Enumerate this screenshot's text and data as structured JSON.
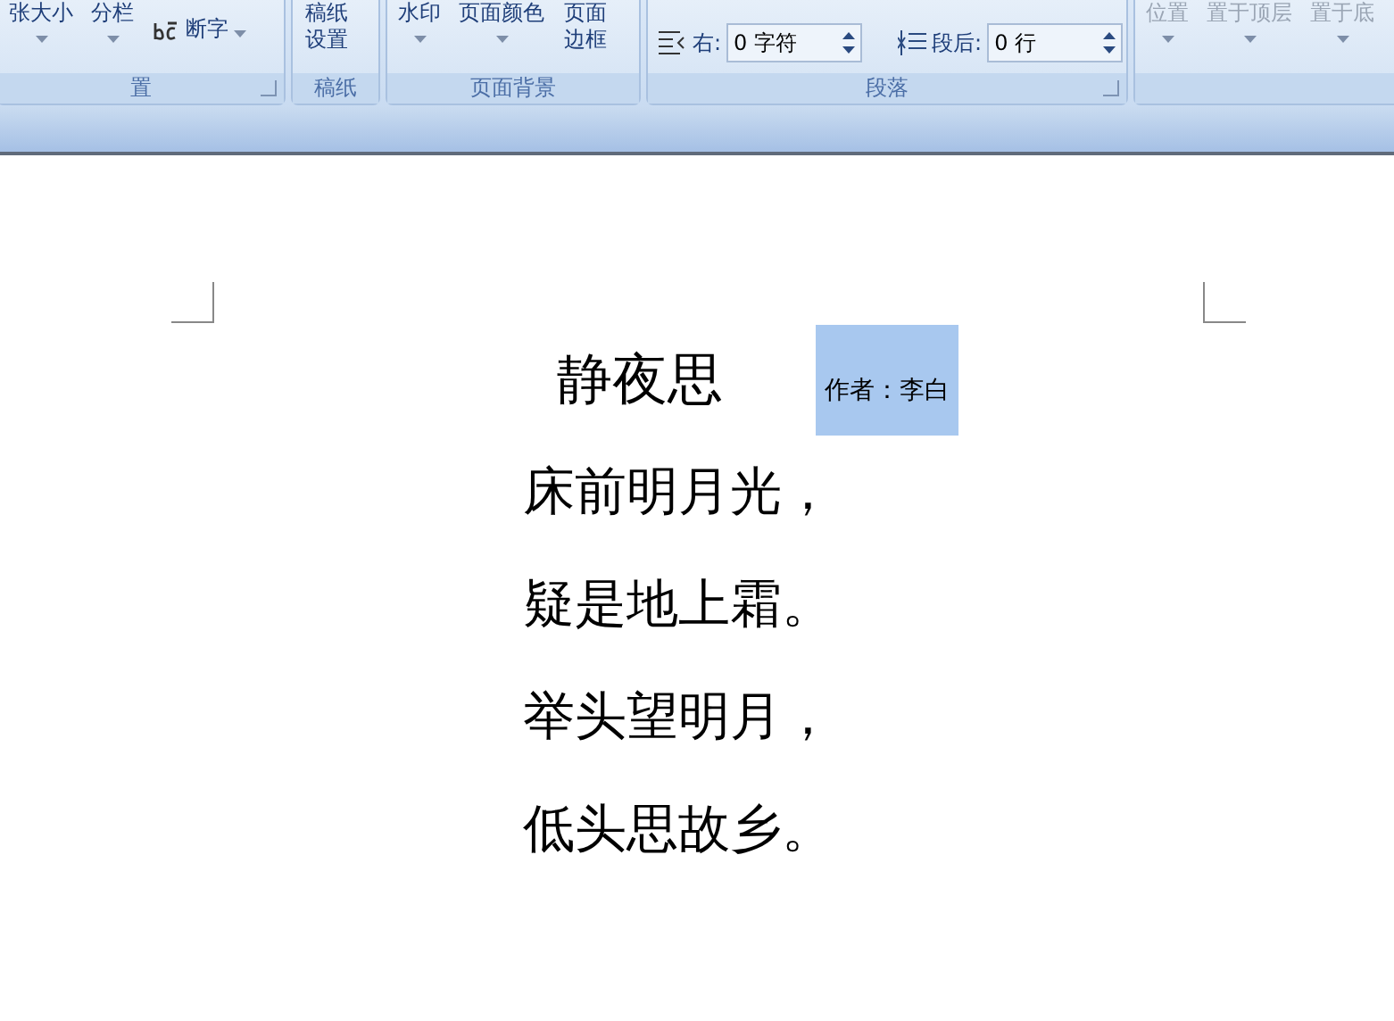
{
  "ribbon": {
    "groups": [
      {
        "label": "置",
        "dialog_launcher": true,
        "items": [
          {
            "kind": "dropdown",
            "label": "张大小",
            "disabled": false
          },
          {
            "kind": "dropdown",
            "label": "分栏",
            "disabled": false
          },
          {
            "kind": "hyphen",
            "label": "断字",
            "disabled": false
          }
        ]
      },
      {
        "label": "稿纸",
        "dialog_launcher": false,
        "items": [
          {
            "kind": "large",
            "label": "稿纸设置",
            "disabled": false
          }
        ]
      },
      {
        "label": "页面背景",
        "dialog_launcher": false,
        "items": [
          {
            "kind": "dropdown",
            "label": "水印",
            "disabled": false
          },
          {
            "kind": "dropdown",
            "label": "页面颜色",
            "disabled": false
          },
          {
            "kind": "large",
            "label": "页面边框",
            "disabled": false
          }
        ]
      },
      {
        "label": "段落",
        "dialog_launcher": true,
        "items": [
          {
            "kind": "spin",
            "label": "右:",
            "value": "0 字符"
          },
          {
            "kind": "spin",
            "label": "段后:",
            "value": "0 行"
          }
        ]
      },
      {
        "dialog_launcher": false,
        "items": [
          {
            "kind": "dropdown",
            "label": "位置",
            "disabled": true
          },
          {
            "kind": "dropdown",
            "label": "置于顶层",
            "disabled": true
          },
          {
            "kind": "dropdown",
            "label": "置于底",
            "disabled": true
          }
        ]
      }
    ]
  },
  "document": {
    "title": "静夜思",
    "author": {
      "text": "作者：李白",
      "selected": true
    },
    "lines": [
      "床前明月光，",
      "疑是地上霜。",
      "举头望明月，",
      "低头思故乡。"
    ]
  }
}
